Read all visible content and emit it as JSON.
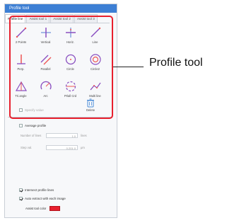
{
  "window": {
    "title": "Profile tool"
  },
  "tabs": [
    "Profile line",
    "Assist tool 1",
    "Assist tool 2",
    "Assist tool 3"
  ],
  "tools": [
    {
      "label": "2 Points",
      "icon": "two-points-line-icon"
    },
    {
      "label": "Vertical",
      "icon": "vertical-line-icon"
    },
    {
      "label": "Horiz.",
      "icon": "horizontal-line-icon"
    },
    {
      "label": "Line",
      "icon": "line-icon"
    },
    {
      "label": "Perp.",
      "icon": "perpendicular-icon"
    },
    {
      "label": "Parallel",
      "icon": "parallel-icon"
    },
    {
      "label": "Circle",
      "icon": "circle-icon"
    },
    {
      "label": "Circle2",
      "icon": "concentric-circle-icon"
    },
    {
      "label": "Tri.angle",
      "icon": "triangle-icon"
    },
    {
      "label": "Arc",
      "icon": "arc-icon"
    },
    {
      "label": "Pt/all Crd",
      "icon": "partial-circle-icon"
    },
    {
      "label": "Multi line",
      "icon": "multi-line-icon"
    }
  ],
  "specify_value": {
    "label": "Specify value",
    "checked": false
  },
  "delete": {
    "label": "Delete",
    "icon": "trash-icon"
  },
  "average_profile": {
    "label": "Average profile",
    "checked": false
  },
  "fields": [
    {
      "label": "Number of lines",
      "value": "1.0",
      "unit": "lines"
    },
    {
      "label": "Step val.",
      "value": "0.201.0",
      "unit": "μm"
    }
  ],
  "options": [
    {
      "label": "Intersect profile lines",
      "checked": true
    },
    {
      "label": "Auto extract with each image",
      "checked": true
    }
  ],
  "line_color": {
    "label": "Assist tool color",
    "color": "#e8202e"
  },
  "callout": {
    "text": "Profile tool"
  },
  "colors": {
    "accent": "#3d7fd4",
    "highlight": "#e8202e"
  }
}
